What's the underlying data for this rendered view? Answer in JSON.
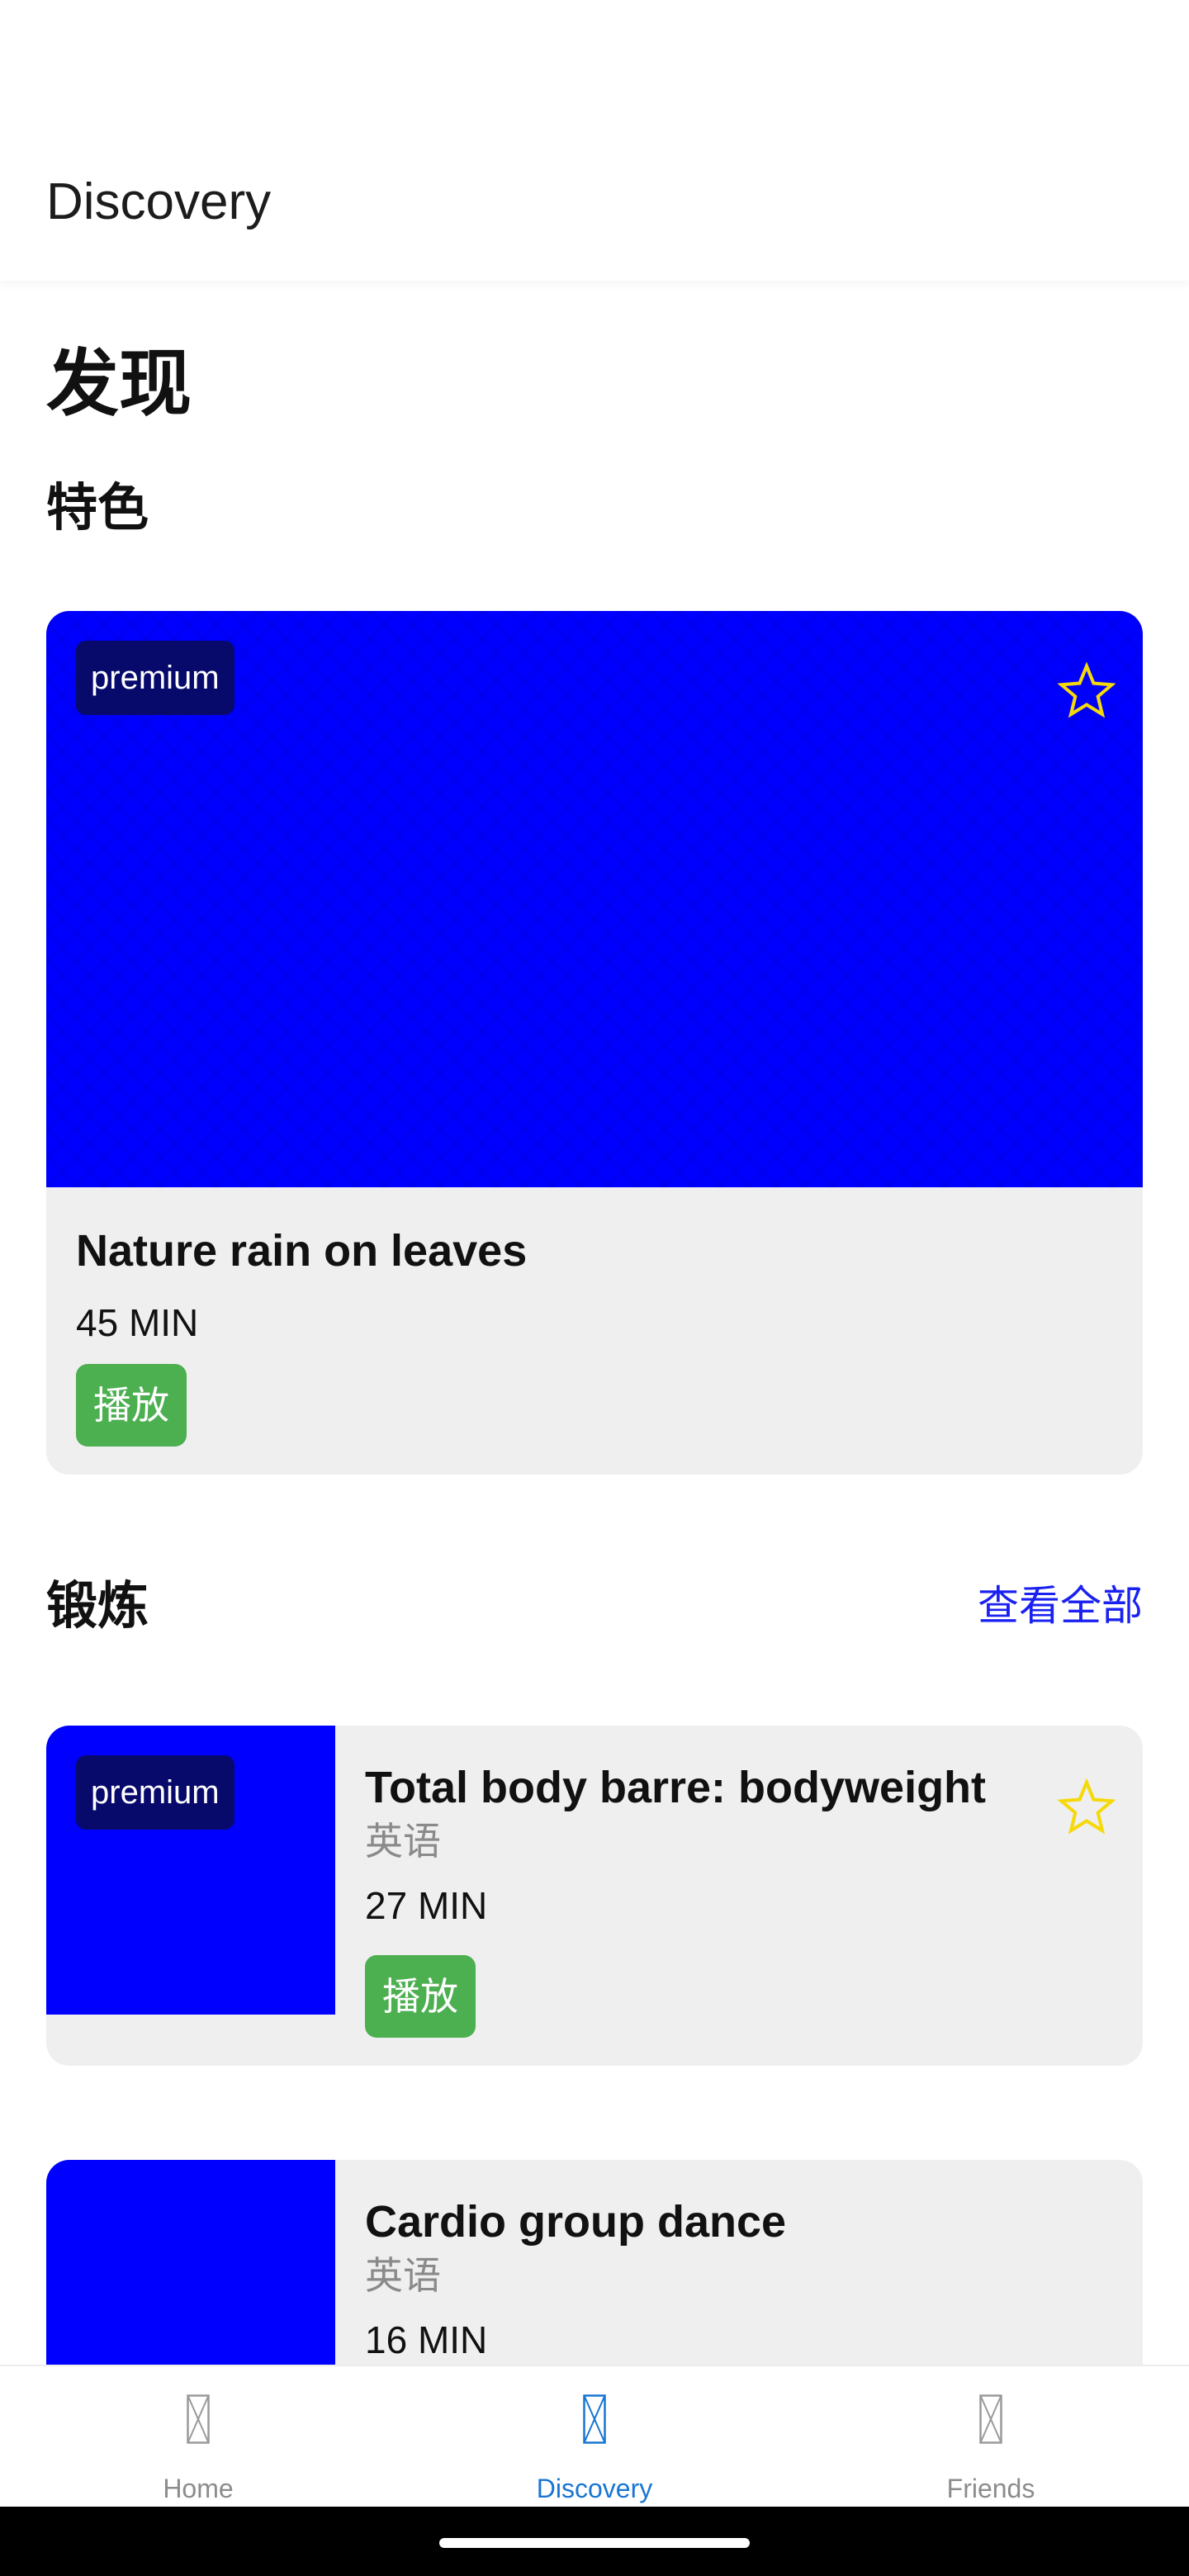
{
  "app_bar": {
    "title": "Discovery"
  },
  "page": {
    "heading": "发现"
  },
  "featured": {
    "heading": "特色",
    "card": {
      "badge": "premium",
      "title": "Nature rain on leaves",
      "duration": "45 MIN",
      "play_label": "播放",
      "favorite_icon": "star-outline-icon",
      "image_color": "#0000ff"
    }
  },
  "workout": {
    "heading": "锻炼",
    "see_all_label": "查看全部",
    "items": [
      {
        "badge": "premium",
        "title": "Total body barre: bodyweight",
        "language": "英语",
        "duration": "27 MIN",
        "play_label": "播放",
        "favorite_icon": "star-outline-icon"
      },
      {
        "title": "Cardio group dance",
        "language": "英语",
        "duration": "16 MIN"
      }
    ]
  },
  "bottom_nav": {
    "items": [
      {
        "label": "Home",
        "icon": "missing-image-icon",
        "active": false
      },
      {
        "label": "Discovery",
        "icon": "missing-image-icon",
        "active": true
      },
      {
        "label": "Friends",
        "icon": "missing-image-icon",
        "active": false
      }
    ]
  },
  "colors": {
    "accent_blue": "#1a21f0",
    "nav_active": "#1976d2",
    "play_green": "#4caf50",
    "star_yellow": "#f5d90a",
    "badge_bg": "#070a6b",
    "card_bg": "#efefef"
  }
}
